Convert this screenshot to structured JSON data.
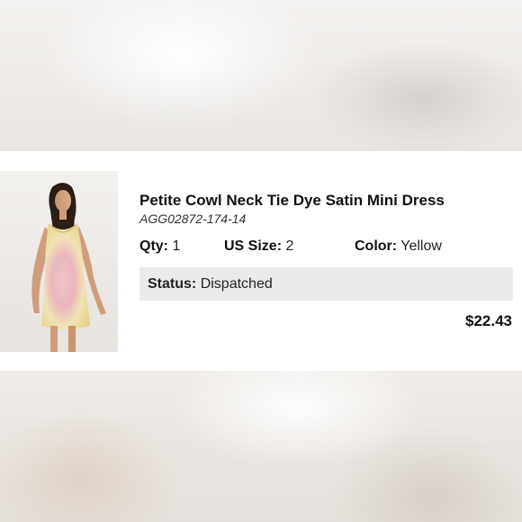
{
  "order_item": {
    "title": "Petite Cowl Neck Tie Dye Satin Mini Dress",
    "sku": "AGG02872-174-14",
    "qty_label": "Qty:",
    "qty_value": "1",
    "size_label": "US Size:",
    "size_value": "2",
    "color_label": "Color:",
    "color_value": "Yellow",
    "status_label": "Status:",
    "status_value": "Dispatched",
    "price": "$22.43"
  },
  "colors": {
    "status_bg": "#ebebeb",
    "card_bg": "#ffffff",
    "text": "#111111"
  },
  "icons": {
    "product_image": "tie-dye-satin-dress-photo"
  }
}
